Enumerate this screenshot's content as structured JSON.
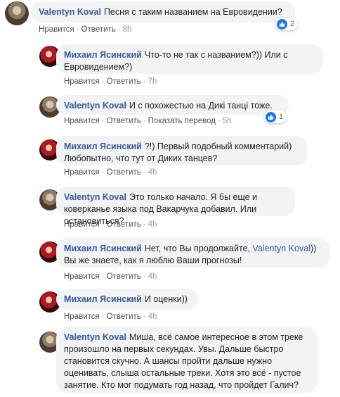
{
  "comments": [
    {
      "author": "Valentyn Koval",
      "text": "Песня с таким названием на Евровидении?",
      "actions": {
        "like": "Нравится",
        "reply": "Ответить",
        "time": "8h"
      },
      "reactions": "2"
    },
    {
      "author": "Михаил Ясинский",
      "text": "Что-то не так с названием?)) Или с Евровидением?)",
      "actions": {
        "like": "Нравится",
        "reply": "Ответить",
        "time": "7h"
      }
    },
    {
      "author": "Valentyn Koval",
      "text": "И с похожестью на Дикі танці тоже.",
      "actions": {
        "like": "Нравится",
        "reply": "Ответить",
        "translate": "Показать перевод",
        "time": "5h"
      },
      "reactions": "1"
    },
    {
      "author": "Михаил Ясинский",
      "text": "?!) Первый подобный комментарий) Любопытно, что тут от Диких танцев?",
      "actions": {
        "like": "Нравится",
        "reply": "Ответить",
        "time": "4h"
      }
    },
    {
      "author": "Valentyn Koval",
      "text": "Это только начало. Я бы еще и коверканье языка под Вакарчука добавил. Или остановиться?",
      "actions": {
        "like": "Нравится",
        "reply": "Ответить",
        "time": "4h"
      }
    },
    {
      "author": "Михаил Ясинский",
      "text_before": "Нет, что Вы продолжайте,",
      "mention": "Valentyn Koval",
      "text_after": ")) Вы же знаете, как я люблю Ваши прогнозы!",
      "actions": {
        "like": "Нравится",
        "reply": "Ответить",
        "time": "4h"
      }
    },
    {
      "author": "Михаил Ясинский",
      "text": "И оценки))",
      "actions": {
        "like": "Нравится",
        "reply": "Ответить",
        "time": "4h"
      }
    },
    {
      "author": "Valentyn Koval",
      "text": "Миша, всё самое интересное в этом треке произошло на первых секундах. Увы. Дальше быстро становится скучно. А шансы пройти дальше нужно оценивать, слыша остальные треки. Хотя это всё - пустое занятие. Кто мог подумать год назад, что пройдет Галич?"
    }
  ],
  "colors": {
    "author": "#385898",
    "bubble": "#f2f3f5",
    "like": "#1877f2"
  },
  "icons": {
    "reaction": "thumbs-up-icon"
  }
}
